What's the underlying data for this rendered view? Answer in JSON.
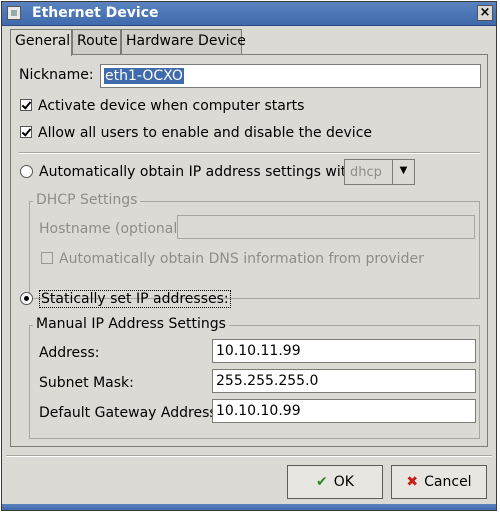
{
  "window": {
    "title": "Ethernet Device",
    "close_glyph": "×"
  },
  "tabs": [
    {
      "label": "General"
    },
    {
      "label": "Route"
    },
    {
      "label": "Hardware Device"
    }
  ],
  "general": {
    "nickname_label": "Nickname:",
    "nickname_value": "eth1-OCXO",
    "activate_on_start": {
      "label": "Activate device when computer starts",
      "checked": true
    },
    "allow_all_users": {
      "label": "Allow all users to enable and disable the device",
      "checked": true
    },
    "auto_ip": {
      "label": "Automatically obtain IP address settings with:",
      "selected": false,
      "protocol": "dhcp"
    },
    "dhcp_settings": {
      "title": "DHCP Settings",
      "hostname_label": "Hostname (optional):",
      "hostname_value": "",
      "auto_dns": {
        "label": "Automatically obtain DNS information from provider",
        "checked": false
      }
    },
    "static_ip": {
      "label": "Statically set IP addresses:",
      "selected": true
    },
    "manual_settings": {
      "title": "Manual IP Address Settings",
      "address_label": "Address:",
      "address_value": "10.10.11.99",
      "subnet_label": "Subnet Mask:",
      "subnet_value": "255.255.255.0",
      "gateway_label": "Default Gateway Address:",
      "gateway_value": "10.10.10.99"
    }
  },
  "buttons": {
    "ok_label": "OK",
    "ok_icon": "check-icon",
    "cancel_label": "Cancel",
    "cancel_icon": "x-icon"
  }
}
